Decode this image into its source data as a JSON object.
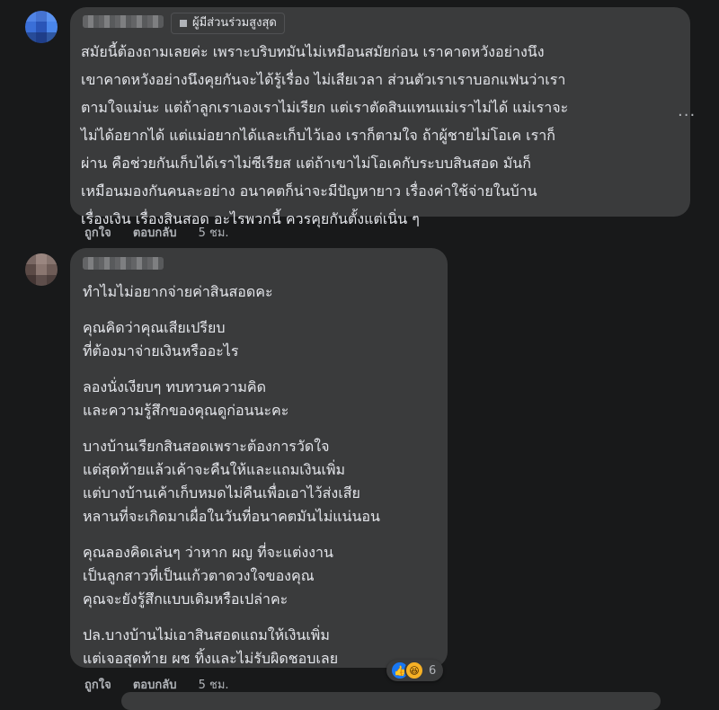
{
  "comment1": {
    "badge": "ผู้มีส่วนร่วมสูงสุด",
    "lines": [
      "สมัยนี้ต้องถามเลยค่ะ เพราะบริบทมันไม่เหมือนสมัยก่อน เราคาดหวังอย่างนึง",
      "เขาคาดหวังอย่างนึงคุยกันจะได้รู้เรื่อง ไม่เสียเวลา ส่วนตัวเราเราบอกแฟนว่าเรา",
      "ตามใจแม่นะ แต่ถ้าลูกเราเองเราไม่เรียก แต่เราตัดสินแทนแม่เราไม่ได้ แม่เราจะ",
      "ไม่ได้อยากได้ แต่แม่อยากได้และเก็บไว้เอง เราก็ตามใจ ถ้าผู้ชายไม่โอเค เราก็",
      "ผ่าน คือช่วยกันเก็บได้เราไม่ซีเรียส แต่ถ้าเขาไม่โอเคกับระบบสินสอด มันก็",
      "เหมือนมองกันคนละอย่าง อนาคตก็น่าจะมีปัญหายาว เรื่องค่าใช้จ่ายในบ้าน",
      "เรื่องเงิน เรื่องสินสอด อะไรพวกนี้ ควรคุยกันตั้งแต่เนิ่น ๆ"
    ],
    "actions": {
      "like": "ถูกใจ",
      "reply": "ตอบกลับ",
      "time": "5 ชม."
    }
  },
  "comment2": {
    "paragraphs": [
      [
        "ทำไมไม่อยากจ่ายค่าสินสอดคะ"
      ],
      [
        "คุณคิดว่าคุณเสียเปรียบ",
        "ที่ต้องมาจ่ายเงินหรืออะไร"
      ],
      [
        "ลองนั่งเงียบๆ ทบทวนความคิด",
        "และความรู้สึกของคุณดูก่อนนะคะ"
      ],
      [
        "บางบ้านเรียกสินสอดเพราะต้องการวัดใจ",
        "แต่สุดท้ายแล้วเค้าจะคืนให้และแถมเงินเพิ่ม",
        "แต่บางบ้านเค้าเก็บหมดไม่คืนเพื่อเอาไว้ส่งเสีย",
        "หลานที่จะเกิดมาเผื่อในวันที่อนาคตมันไม่แน่นอน"
      ],
      [
        "คุณลองคิดเล่นๆ ว่าหาก ผญ ที่จะแต่งงาน",
        "เป็นลูกสาวที่เป็นแก้วตาดวงใจของคุณ",
        "คุณจะยังรู้สึกแบบเดิมหรือเปล่าคะ"
      ],
      [
        "ปล.บางบ้านไม่เอาสินสอดแถมให้เงินเพิ่ม",
        "แต่เจอสุดท้าย ผช ทิ้งและไม่รับผิดชอบเลย"
      ]
    ],
    "reactions": {
      "count": "6",
      "icons": [
        "like-icon",
        "haha-icon"
      ]
    },
    "actions": {
      "like": "ถูกใจ",
      "reply": "ตอบกลับ",
      "time": "5 ชม."
    }
  },
  "more_button": "···"
}
